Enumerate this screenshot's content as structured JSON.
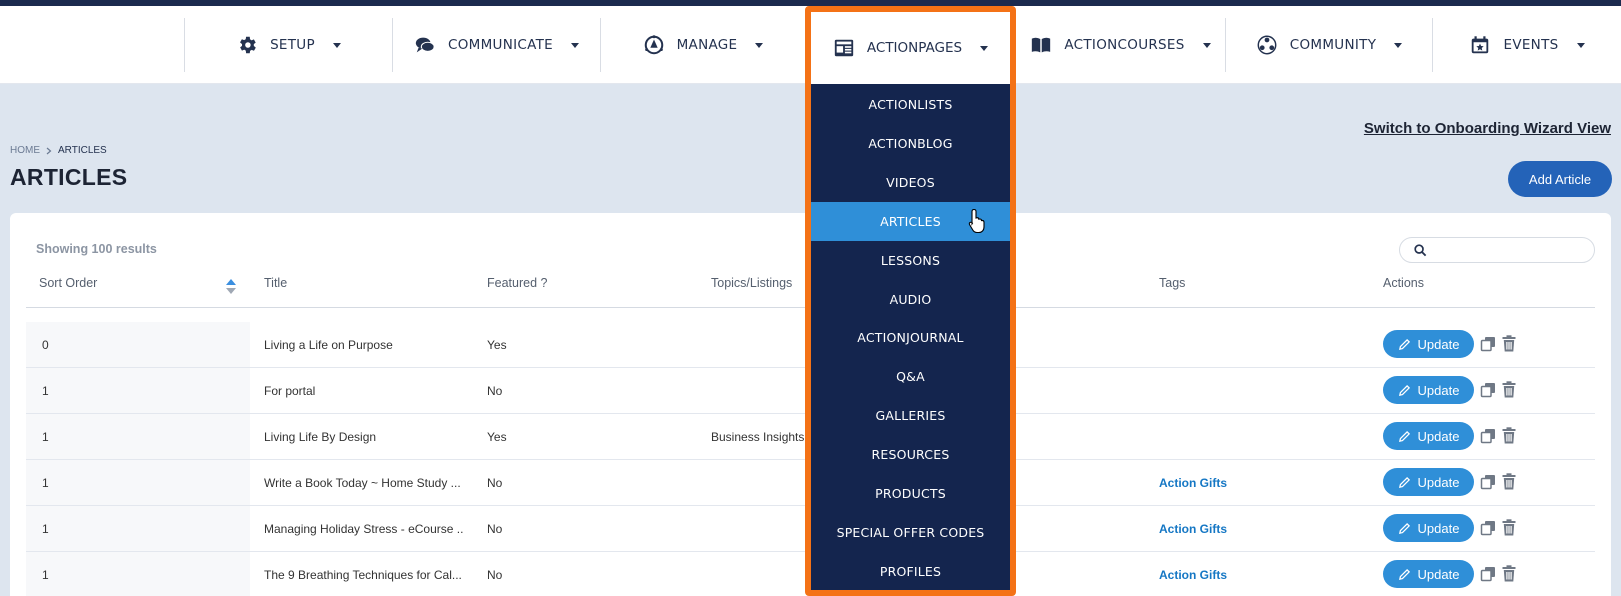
{
  "nav": {
    "items": [
      {
        "label": "SETUP",
        "icon": "gear-icon"
      },
      {
        "label": "COMMUNICATE",
        "icon": "chat-bubbles-icon"
      },
      {
        "label": "MANAGE",
        "icon": "manage-icon"
      },
      {
        "label": "ACTIONPAGES",
        "icon": "newspaper-icon"
      },
      {
        "label": "ACTIONCOURSES",
        "icon": "book-open-icon"
      },
      {
        "label": "COMMUNITY",
        "icon": "community-icon"
      },
      {
        "label": "EVENTS",
        "icon": "calendar-star-icon"
      }
    ]
  },
  "dropdown": {
    "items": [
      "ACTIONLISTS",
      "ACTIONBLOG",
      "VIDEOS",
      "ARTICLES",
      "LESSONS",
      "AUDIO",
      "ACTIONJOURNAL",
      "Q&A",
      "GALLERIES",
      "RESOURCES",
      "PRODUCTS",
      "SPECIAL OFFER CODES",
      "PROFILES"
    ],
    "active": "ARTICLES"
  },
  "breadcrumb": {
    "home": "HOME",
    "current": "ARTICLES"
  },
  "page": {
    "title": "ARTICLES",
    "switch_link": "Switch to Onboarding Wizard View",
    "add_button": "Add Article",
    "results": "Showing 100 results"
  },
  "table": {
    "headers": {
      "sort_order": "Sort Order",
      "title": "Title",
      "featured": "Featured ?",
      "topics": "Topics/Listings",
      "tags": "Tags",
      "actions": "Actions"
    },
    "update_label": "Update",
    "rows": [
      {
        "sort": "0",
        "title": "Living a Life on Purpose",
        "featured": "Yes",
        "topics": "",
        "tags": ""
      },
      {
        "sort": "1",
        "title": "For portal",
        "featured": "No",
        "topics": "",
        "tags": ""
      },
      {
        "sort": "1",
        "title": "Living Life By Design",
        "featured": "Yes",
        "topics": "Business Insights,",
        "tags": ""
      },
      {
        "sort": "1",
        "title": "Write a Book Today ~ Home Study ...",
        "featured": "No",
        "topics": "",
        "tags": "Action Gifts"
      },
      {
        "sort": "1",
        "title": "Managing Holiday Stress - eCourse ...",
        "featured": "No",
        "topics": "",
        "tags": "Action Gifts"
      },
      {
        "sort": "1",
        "title": "The 9 Breathing Techniques for Cal...",
        "featured": "No",
        "topics": "",
        "tags": "Action Gifts"
      }
    ]
  },
  "colors": {
    "accent": "#2f8fd8",
    "navy": "#14254e",
    "highlight": "#f47216",
    "brand_button": "#2463b8"
  }
}
